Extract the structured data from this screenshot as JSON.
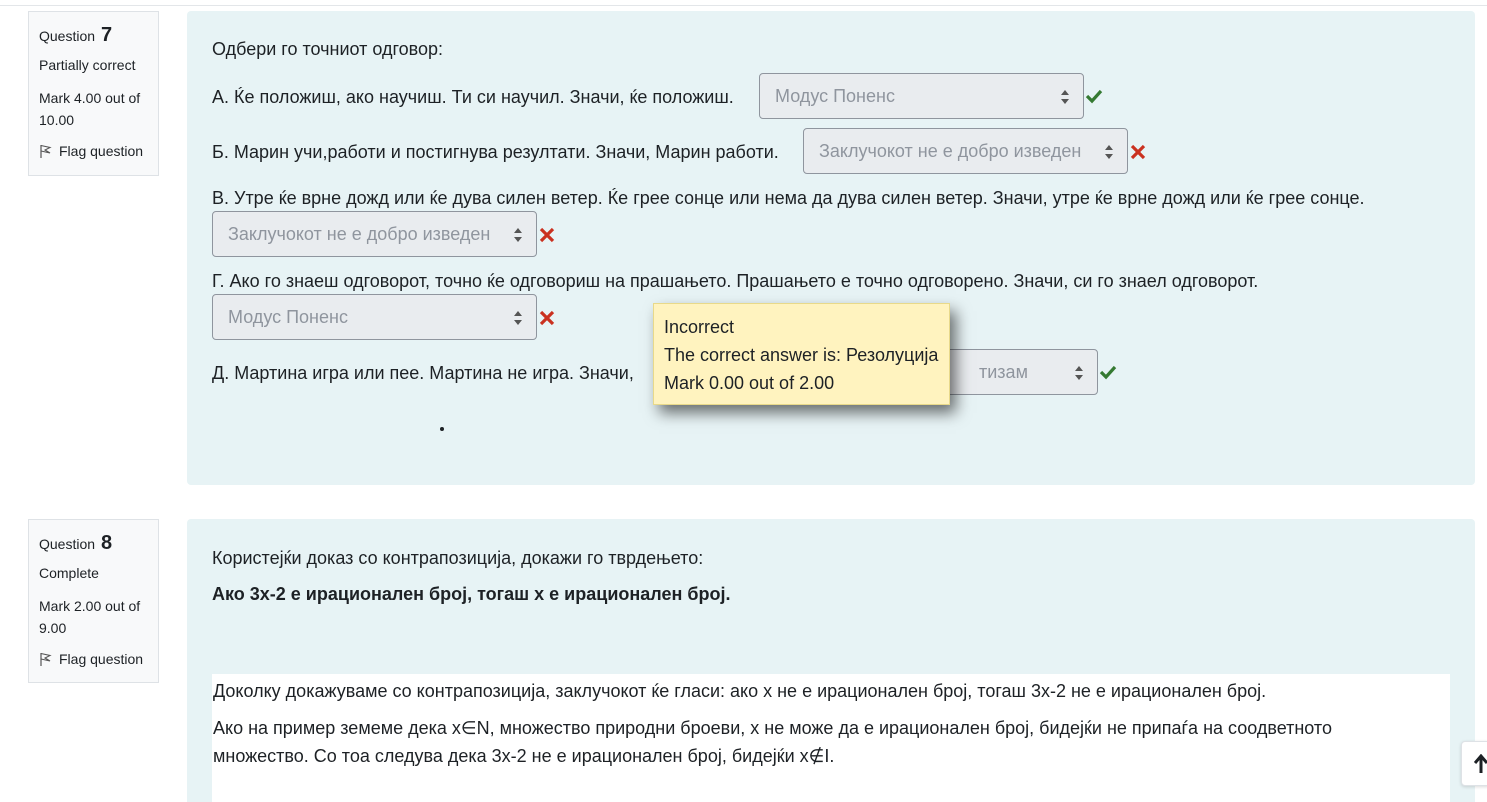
{
  "question7": {
    "label": "Question",
    "number": "7",
    "state": "Partially correct",
    "grade": "Mark 4.00 out of 10.00",
    "flag_label": "Flag question",
    "prompt": "Одбери го точниот одговор:",
    "items": [
      {
        "text": "А. Ќе положиш, ако научиш. Ти си научил. Значи, ќе положиш.",
        "selected": "Модус Поненс",
        "result": "correct"
      },
      {
        "text": "Б. Марин учи,работи и постигнува резултати. Значи, Марин работи.",
        "selected": "Заклучокот не е добро изведен",
        "result": "incorrect"
      },
      {
        "text": "В. Утре ќе врне дожд или ќе дува силен ветер. Ќе грее сонце или нема да дува силен ветер. Значи, утре ќе врне дожд или ќе грее сонце.",
        "selected": "Заклучокот не е добро изведен",
        "result": "incorrect"
      },
      {
        "text": "Г. Ако го знаеш одговорот, точно ќе одговориш на прашањето. Прашањето е точно одговорено. Значи, си го знаел одговорот.",
        "selected": "Модус Поненс",
        "result": "incorrect"
      },
      {
        "text": "Д. Мартина игра или пее. Мартина не игра. Значи,",
        "selected": "тизам",
        "result": "correct"
      }
    ],
    "tooltip": {
      "status": "Incorrect",
      "correct_answer": "The correct answer is: Резолуција",
      "mark": "Mark 0.00 out of 2.00"
    }
  },
  "question8": {
    "label": "Question",
    "number": "8",
    "state": "Complete",
    "grade": "Mark 2.00 out of 9.00",
    "flag_label": "Flag question",
    "prompt": "Користејќи доказ со контрапозиција, докажи го тврдењето:",
    "statement": "Ако 3x-2 е ирационален број, тогаш x е ирационален број.",
    "answer_lines": [
      "Доколку докажуваме со контрапозиција, заклучокот ќе гласи: ако x не е ирационален број, тогаш 3x-2 не е ирационален број.",
      "Ако на пример  земеме дека x∈N, множество природни броеви, x не може да е ирационален број, бидејќи не припаѓа на соодветното",
      "множество. Со тоа следува дека 3x-2 не е ирационален број, бидејќи x∉I."
    ]
  },
  "colors": {
    "content_bg": "#e7f3f5",
    "correct": "#357a32",
    "incorrect": "#ca3120",
    "tooltip_bg": "#fff3bf"
  },
  "icons": {
    "flag": "flag-icon",
    "correct": "check-icon",
    "incorrect": "cross-icon",
    "select": "select-arrows-icon",
    "scroll": "arrow-up-icon"
  }
}
